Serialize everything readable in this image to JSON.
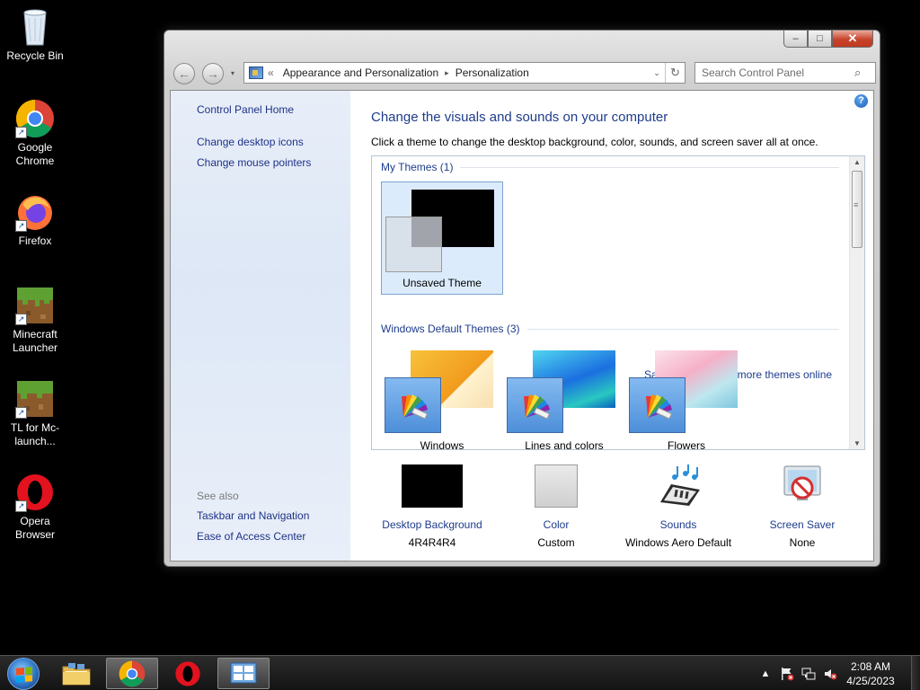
{
  "desktop": {
    "icons": [
      {
        "label": "Recycle Bin"
      },
      {
        "label": "Google Chrome"
      },
      {
        "label": "Firefox"
      },
      {
        "label": "Minecraft Launcher"
      },
      {
        "label": "TL for Mc-launch..."
      },
      {
        "label": "Opera Browser"
      }
    ]
  },
  "window": {
    "controls": {
      "minimize": "–",
      "maximize": "□",
      "close": "✕"
    },
    "nav": {
      "back": "←",
      "forward": "→",
      "history": "▾"
    },
    "address": {
      "overflow": "«",
      "segments": [
        "Appearance and Personalization",
        "Personalization"
      ],
      "separator": "▸",
      "dropdown": "⌄",
      "refresh": "↻"
    },
    "search": {
      "placeholder": "Search Control Panel",
      "icon": "⌕"
    },
    "help": "?",
    "sidebar": {
      "links": [
        "Control Panel Home",
        "Change desktop icons",
        "Change mouse pointers"
      ],
      "see_also": "See also",
      "see_also_links": [
        "Taskbar and Navigation",
        "Ease of Access Center"
      ]
    },
    "heading": "Change the visuals and sounds on your computer",
    "subtext": "Click a theme to change the desktop background, color, sounds, and screen saver all at once.",
    "my_themes": {
      "header": "My Themes (1)",
      "items": [
        {
          "name": "Unsaved Theme"
        }
      ],
      "save_link": "Save theme",
      "more_link": "Get more themes online"
    },
    "default_themes": {
      "header": "Windows Default Themes (3)",
      "items": [
        {
          "name": "Windows"
        },
        {
          "name": "Lines and colors"
        },
        {
          "name": "Flowers"
        }
      ]
    },
    "scroll": {
      "up": "▲",
      "down": "▼"
    },
    "bottom": [
      {
        "label": "Desktop Background",
        "value": "4R4R4R4"
      },
      {
        "label": "Color",
        "value": "Custom"
      },
      {
        "label": "Sounds",
        "value": "Windows Aero Default"
      },
      {
        "label": "Screen Saver",
        "value": "None"
      }
    ]
  },
  "taskbar": {
    "tray_arrow": "▲",
    "clock": {
      "time": "2:08 AM",
      "date": "4/25/2023"
    }
  },
  "colors": {
    "accent_link": "#1e3c8c",
    "selection": "#dcebfc",
    "close_button": "#c8432b"
  }
}
